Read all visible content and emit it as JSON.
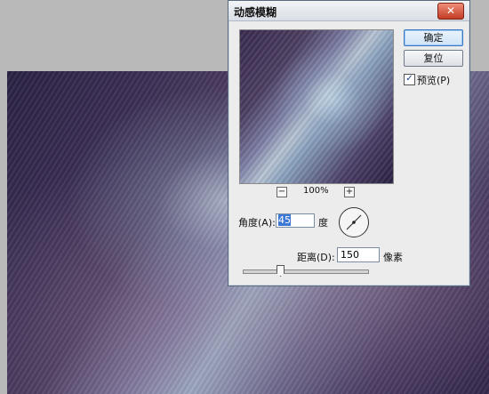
{
  "dialog": {
    "title": "动感模糊",
    "close_glyph": "✕",
    "ok_label": "确定",
    "reset_label": "复位",
    "preview_checked": true,
    "preview_label": "预览(P)",
    "zoom": "100%",
    "zoom_minus": "−",
    "zoom_plus": "+",
    "angle_label": "角度(A):",
    "angle_value": "45",
    "degree_unit": "度",
    "distance_label": "距离(D):",
    "distance_value": "150",
    "pixel_unit": "像素",
    "distance_slider_level": 0.3
  },
  "colors": {
    "accent": "#3d78d7",
    "close_button": "#c23c24"
  },
  "icons": {
    "checkbox": "check-icon",
    "angle_dial": "angle-dial-icon"
  }
}
